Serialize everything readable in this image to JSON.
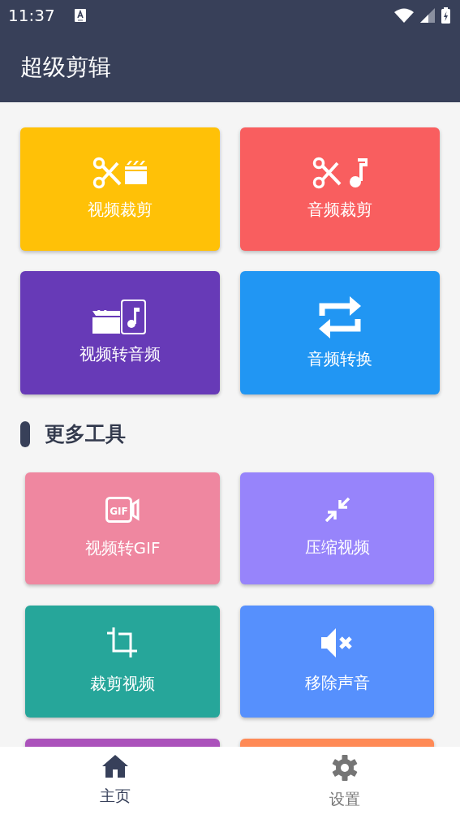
{
  "status_bar": {
    "time": "11:37"
  },
  "app_bar": {
    "title": "超级剪辑"
  },
  "main_tiles": [
    {
      "label": "视频裁剪",
      "color": "#ffc107"
    },
    {
      "label": "音频裁剪",
      "color": "#f95e5f"
    },
    {
      "label": "视频转音频",
      "color": "#673ab7"
    },
    {
      "label": "音频转换",
      "color": "#2196f3"
    }
  ],
  "section": {
    "title": "更多工具"
  },
  "tools": [
    {
      "label": "视频转GIF",
      "color": "#ef87a0",
      "icon_text": "GIF"
    },
    {
      "label": "压缩视频",
      "color": "#9784fb"
    },
    {
      "label": "裁剪视频",
      "color": "#26a69a"
    },
    {
      "label": "移除声音",
      "color": "#5690fd"
    },
    {
      "color": "#ab52bb"
    },
    {
      "color": "#ff8a56"
    }
  ],
  "bottom_nav": [
    {
      "label": "主页",
      "selected": true
    },
    {
      "label": "设置",
      "selected": false
    }
  ]
}
